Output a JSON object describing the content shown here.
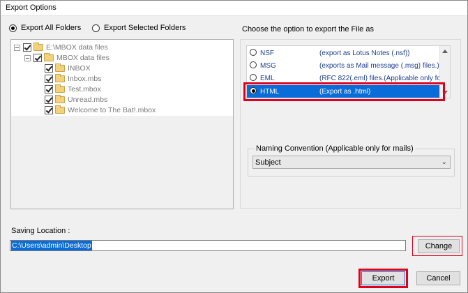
{
  "window": {
    "title": "Export Options"
  },
  "export_scope": {
    "options": [
      {
        "label": "Export All Folders",
        "selected": true
      },
      {
        "label": "Export Selected Folders",
        "selected": false
      }
    ]
  },
  "folder_tree": {
    "root": "E:\\MBOX data files",
    "child": "MBOX data files",
    "files": [
      "INBOX",
      "Inbox.mbs",
      "Test.mbox",
      "Unread.mbs",
      "Welcome to The Bat!.mbox"
    ]
  },
  "format_panel": {
    "heading": "Choose the option to export the File as",
    "items": [
      {
        "name": "NSF",
        "desc": "(export as Lotus Notes (.nsf))",
        "selected": false
      },
      {
        "name": "MSG",
        "desc": "(exports as Mail message (.msg) files.)",
        "selected": false
      },
      {
        "name": "EML",
        "desc": "(RFC 822(.eml) files.(Applicable only for ...",
        "selected": false
      },
      {
        "name": "HTML",
        "desc": "(Export as .html)",
        "selected": true
      }
    ],
    "highlight_color": "#e0001b",
    "selection_color": "#0a6cd8"
  },
  "naming_convention": {
    "legend": "Naming Convention (Applicable only for mails)",
    "selected": "Subject"
  },
  "saving_location": {
    "label": "Saving Location :",
    "value": "C:\\Users\\admin\\Desktop"
  },
  "buttons": {
    "change": "Change",
    "export": "Export",
    "cancel": "Cancel"
  }
}
